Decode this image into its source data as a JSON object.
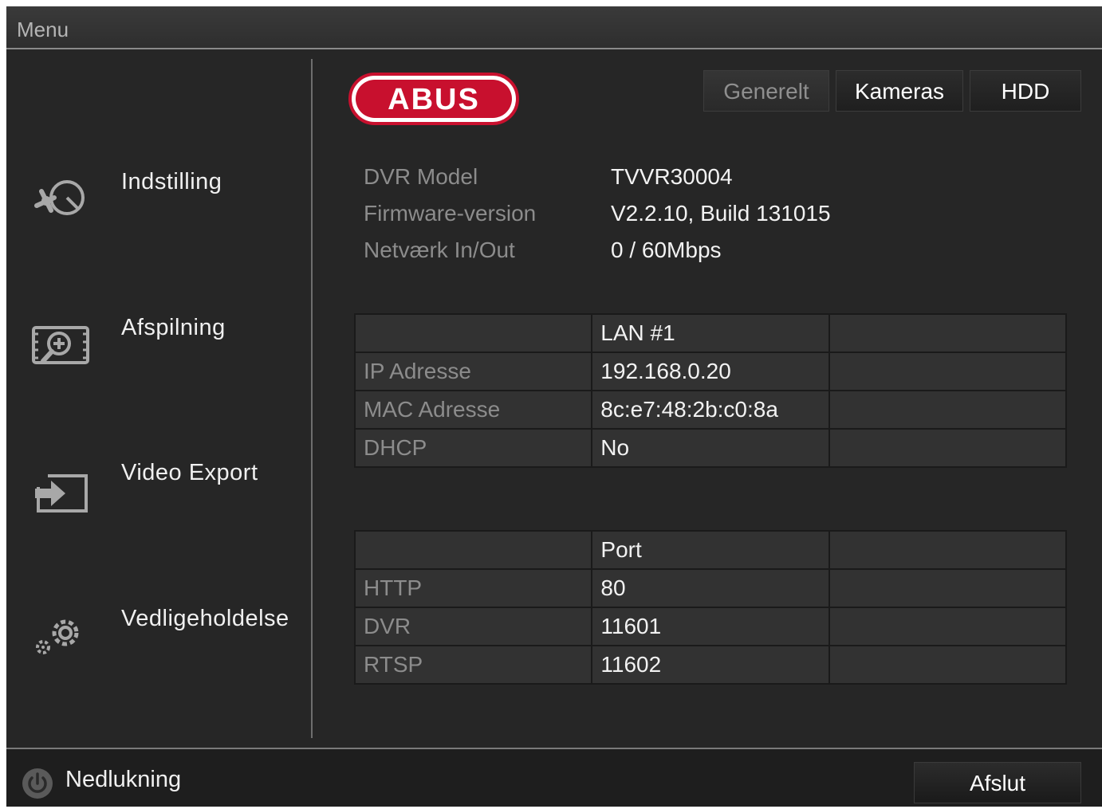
{
  "window": {
    "title": "Menu"
  },
  "sidebar": {
    "items": [
      {
        "label": "Indstilling",
        "icon": "settings-tools-icon"
      },
      {
        "label": "Afspilning",
        "icon": "playback-search-icon"
      },
      {
        "label": "Video Export",
        "icon": "export-icon"
      },
      {
        "label": "Vedligeholdelse",
        "icon": "maintenance-gears-icon"
      }
    ]
  },
  "header": {
    "logo_text": "ABUS",
    "tabs": [
      {
        "label": "Generelt",
        "active": true
      },
      {
        "label": "Kameras",
        "active": false
      },
      {
        "label": "HDD",
        "active": false
      }
    ]
  },
  "info": {
    "rows": [
      {
        "label": "DVR Model",
        "value": "TVVR30004"
      },
      {
        "label": "Firmware-version",
        "value": "V2.2.10, Build 131015"
      },
      {
        "label": "Netværk In/Out",
        "value": "0 / 60Mbps"
      }
    ]
  },
  "network_table": {
    "header": [
      "",
      "LAN #1",
      ""
    ],
    "rows": [
      [
        "IP Adresse",
        "192.168.0.20",
        ""
      ],
      [
        "MAC Adresse",
        "8c:e7:48:2b:c0:8a",
        ""
      ],
      [
        "DHCP",
        "No",
        ""
      ]
    ]
  },
  "port_table": {
    "header": [
      "",
      "Port",
      ""
    ],
    "rows": [
      [
        "HTTP",
        "80",
        ""
      ],
      [
        "DVR",
        "11601",
        ""
      ],
      [
        "RTSP",
        "11602",
        ""
      ]
    ]
  },
  "footer": {
    "shutdown_label": "Nedlukning",
    "exit_label": "Afslut"
  },
  "colors": {
    "background": "#262626",
    "logo_red": "#c8102e",
    "label_gray": "#8c8c8c",
    "value_white": "#f2f2f2"
  }
}
